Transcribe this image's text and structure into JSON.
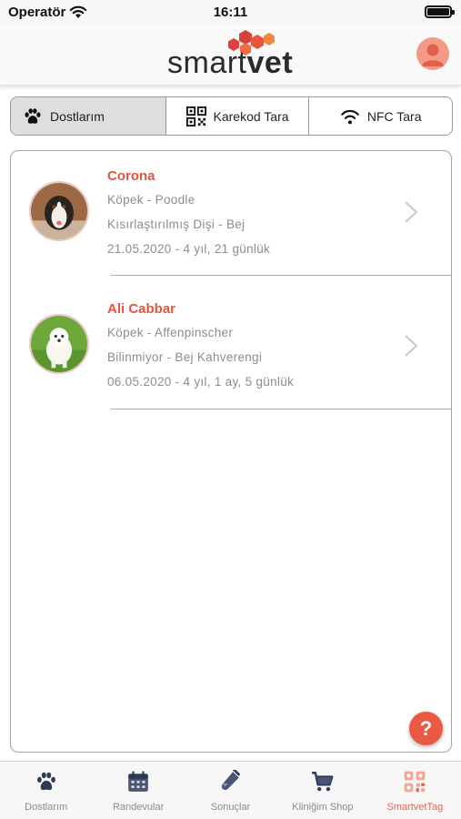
{
  "status_bar": {
    "carrier": "Operatör",
    "time": "16:11"
  },
  "header": {
    "logo_smart": "smart",
    "logo_vet": "vet",
    "brand_color": "#e3553c"
  },
  "segments": [
    {
      "label": "Dostlarım",
      "icon": "paw-icon",
      "active": true
    },
    {
      "label": "Karekod Tara",
      "icon": "qr-code-icon",
      "active": false
    },
    {
      "label": "NFC Tara",
      "icon": "nfc-icon",
      "active": false
    }
  ],
  "pets": [
    {
      "name": "Corona",
      "species_breed": "Köpek - Poodle",
      "status_color": "Kısırlaştırılmış Dişi - Bej",
      "birth_age": "21.05.2020 - 4 yıl, 21 günlük"
    },
    {
      "name": "Ali Cabbar",
      "species_breed": "Köpek - Affenpinscher",
      "status_color": "Bilinmiyor - Bej Kahverengi",
      "birth_age": "06.05.2020 - 4 yıl, 1 ay, 5 günlük"
    }
  ],
  "help_button": {
    "label": "?"
  },
  "tab_bar": {
    "items": [
      {
        "label": "Dostlarım",
        "icon": "paw-icon",
        "active": false
      },
      {
        "label": "Randevular",
        "icon": "calendar-icon",
        "active": false
      },
      {
        "label": "Sonuçlar",
        "icon": "test-tube-icon",
        "active": false
      },
      {
        "label": "Kliniğim Shop",
        "icon": "cart-icon",
        "active": false
      },
      {
        "label": "SmartvetTag",
        "icon": "tag-grid-icon",
        "active": true
      }
    ]
  }
}
